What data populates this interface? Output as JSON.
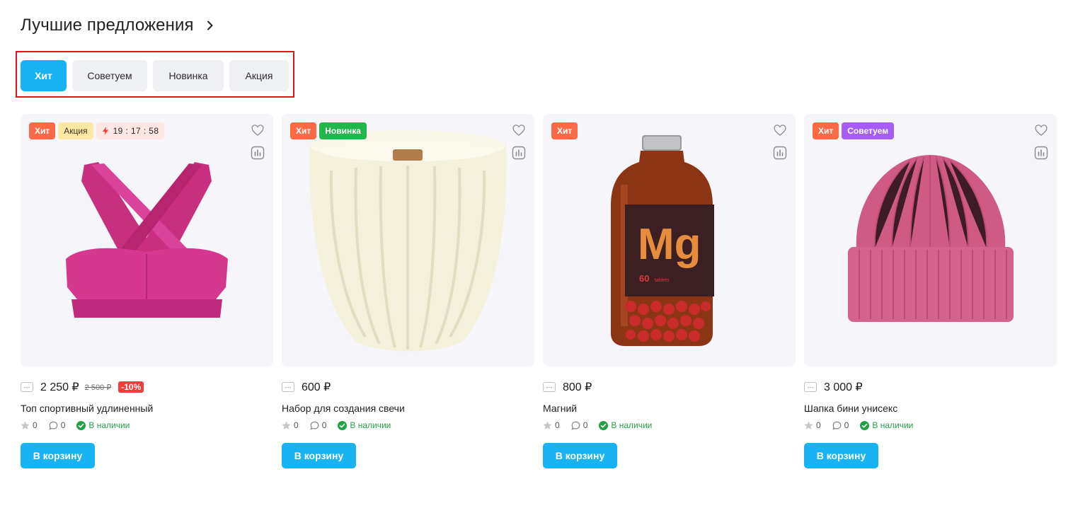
{
  "section": {
    "title": "Лучшие предложения",
    "arrow_icon": "chevron-right-icon"
  },
  "tabs": [
    {
      "label": "Хит",
      "active": true
    },
    {
      "label": "Советуем",
      "active": false
    },
    {
      "label": "Новинка",
      "active": false
    },
    {
      "label": "Акция",
      "active": false
    }
  ],
  "products": [
    {
      "badges": [
        {
          "label": "Хит",
          "kind": "hit"
        },
        {
          "label": "Акция",
          "kind": "sale"
        }
      ],
      "timer": "19 : 17 : 58",
      "image": "pink-sports-top",
      "price": "2 250 ₽",
      "old_price": "2 500 ₽",
      "discount": "-10%",
      "name": "Топ спортивный удлиненный",
      "rating": "0",
      "reviews": "0",
      "stock": "В наличии",
      "cart": "В корзину",
      "more": "..."
    },
    {
      "badges": [
        {
          "label": "Хит",
          "kind": "hit"
        },
        {
          "label": "Новинка",
          "kind": "new"
        }
      ],
      "image": "candle",
      "price": "600 ₽",
      "name": "Набор для создания свечи",
      "rating": "0",
      "reviews": "0",
      "stock": "В наличии",
      "cart": "В корзину"
    },
    {
      "badges": [
        {
          "label": "Хит",
          "kind": "hit"
        }
      ],
      "image": "magnesium-bottle",
      "bottle_label": "Mg",
      "bottle_sub": "60",
      "bottle_sub2": "tablets",
      "price": "800 ₽",
      "name": "Магний",
      "rating": "0",
      "reviews": "0",
      "stock": "В наличии",
      "cart": "В корзину"
    },
    {
      "badges": [
        {
          "label": "Хит",
          "kind": "hit"
        },
        {
          "label": "Советуем",
          "kind": "rec"
        }
      ],
      "image": "pink-beanie",
      "price": "3 000 ₽",
      "name": "Шапка бини унисекс",
      "rating": "0",
      "reviews": "0",
      "stock": "В наличии",
      "cart": "В корзину",
      "more": "..."
    }
  ],
  "colors": {
    "accent": "#17b3f3",
    "hit": "#fa6a45",
    "new": "#23b74b",
    "rec": "#a65cf5",
    "discount": "#f23b3b",
    "stock": "#23a144"
  }
}
